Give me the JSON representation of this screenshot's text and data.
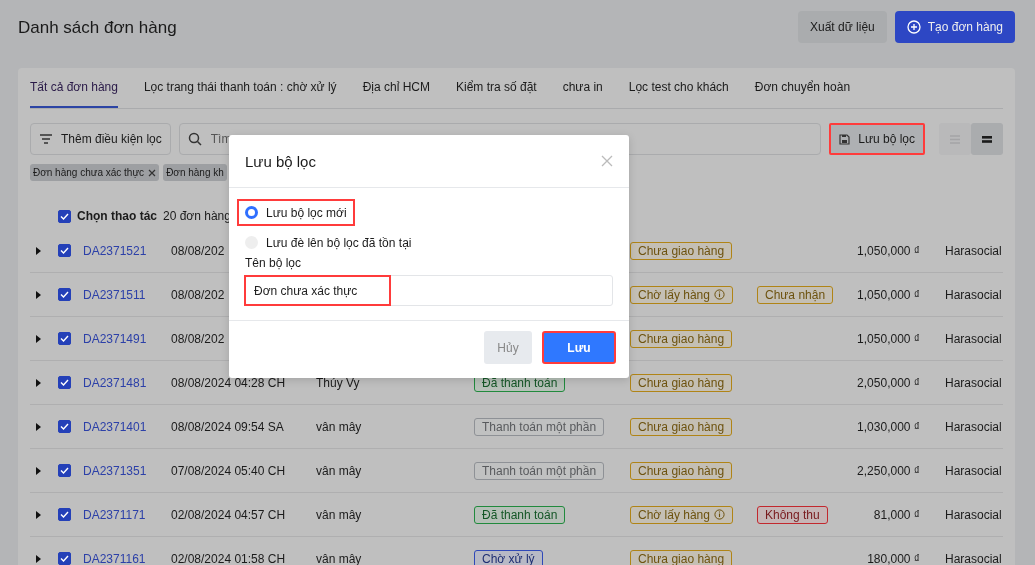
{
  "page": {
    "title": "Danh sách đơn hàng",
    "actions": [
      {
        "kind": "secondary",
        "label": "Xuất dữ liệu"
      },
      {
        "kind": "primary",
        "label": "Tạo đơn hàng"
      }
    ]
  },
  "tabs": [
    {
      "label": "Tất cả đơn hàng",
      "selected": true
    },
    {
      "label": "Lọc trang thái thanh toán : chờ xử lý",
      "selected": false
    },
    {
      "label": "Địa chỉ HCM",
      "selected": false
    },
    {
      "label": "Kiểm tra số đặt",
      "selected": false
    },
    {
      "label": "chưa in",
      "selected": false
    },
    {
      "label": "Lọc test cho khách",
      "selected": false
    },
    {
      "label": "Đơn chuyển hoàn",
      "selected": false
    }
  ],
  "toolbar": {
    "filter_button": "Thêm điều kiện lọc",
    "search": {
      "placeholder": "Tìm"
    },
    "save_filter": {
      "label": "Lưu bộ lọc",
      "highlighted": true
    },
    "view_toggle": [
      {
        "selected": false
      },
      {
        "selected": true
      }
    ]
  },
  "chips": [
    {
      "label": "Đơn hàng chưa xác thực",
      "removable": true
    },
    {
      "label": "Đơn hàng kh",
      "removable": false
    }
  ],
  "selection": {
    "checked": true,
    "label": "Chọn thao tác",
    "count": "20 đơn hàng"
  },
  "rows": [
    {
      "checked": true,
      "code": "DA2371521",
      "date": "08/08/202",
      "delivery": {
        "label": "Chưa giao hàng",
        "color": "#b08416",
        "info": false
      },
      "amount": "1,050,000 ₫",
      "channel": "Harasocial"
    },
    {
      "checked": true,
      "code": "DA2371511",
      "date": "08/08/202",
      "delivery": {
        "label": "Chờ lấy hàng",
        "color": "#b08416",
        "info": true
      },
      "cod": {
        "label": "Chưa nhận",
        "color": "#b08416"
      },
      "amount": "1,050,000 ₫",
      "channel": "Harasocial"
    },
    {
      "checked": true,
      "code": "DA2371491",
      "date": "08/08/202",
      "delivery": {
        "label": "Chưa giao hàng",
        "color": "#b08416",
        "info": false
      },
      "amount": "1,050,000 ₫",
      "channel": "Harasocial"
    },
    {
      "checked": true,
      "code": "DA2371481",
      "date": "08/08/2024 04:28 CH",
      "customer": "Thúy Vy",
      "payment": {
        "label": "Đã thanh toán",
        "color": "#218a3d"
      },
      "delivery": {
        "label": "Chưa giao hàng",
        "color": "#b08416",
        "info": false
      },
      "amount": "2,050,000 ₫",
      "channel": "Harasocial"
    },
    {
      "checked": true,
      "code": "DA2371401",
      "date": "08/08/2024 09:54 SA",
      "customer": "vân mây",
      "payment": {
        "label": "Thanh toán một phần",
        "color": "#8e9196"
      },
      "delivery": {
        "label": "Chưa giao hàng",
        "color": "#b08416",
        "info": false
      },
      "amount": "1,030,000 ₫",
      "channel": "Harasocial"
    },
    {
      "checked": true,
      "code": "DA2371351",
      "date": "07/08/2024 05:40 CH",
      "customer": "vân mây",
      "payment": {
        "label": "Thanh toán một phần",
        "color": "#8e9196"
      },
      "delivery": {
        "label": "Chưa giao hàng",
        "color": "#b08416",
        "info": false
      },
      "amount": "2,250,000 ₫",
      "channel": "Harasocial"
    },
    {
      "checked": true,
      "code": "DA2371171",
      "date": "02/08/2024 04:57 CH",
      "customer": "vân mây",
      "payment": {
        "label": "Đã thanh toán",
        "color": "#218a3d"
      },
      "delivery": {
        "label": "Chờ lấy hàng",
        "color": "#b08416",
        "info": true
      },
      "cod": {
        "label": "Không thu",
        "color": "#c2282e"
      },
      "amount": "81,000 ₫",
      "channel": "Harasocial"
    },
    {
      "checked": true,
      "code": "DA2371161",
      "date": "02/08/2024 01:58 CH",
      "customer": "vân mây",
      "payment": {
        "label": "Chờ xử lý",
        "color": "#2f48b8"
      },
      "delivery": {
        "label": "Chưa giao hàng",
        "color": "#b08416",
        "info": false
      },
      "amount": "180,000 ₫",
      "channel": "Harasocial"
    }
  ],
  "dialog": {
    "title": "Lưu bộ lọc",
    "options": [
      {
        "label": "Lưu bộ lọc mới",
        "selected": true,
        "highlighted": true
      },
      {
        "label": "Lưu đè lên bộ lọc đã tồn tại",
        "selected": false,
        "highlighted": false
      }
    ],
    "field_label": "Tên bộ lọc",
    "field": {
      "value": "Đơn chưa xác thực",
      "highlighted": true
    },
    "buttons": [
      {
        "kind": "cancel",
        "label": "Hủy",
        "highlighted": false
      },
      {
        "kind": "primary",
        "label": "Lưu",
        "highlighted": true
      }
    ]
  }
}
